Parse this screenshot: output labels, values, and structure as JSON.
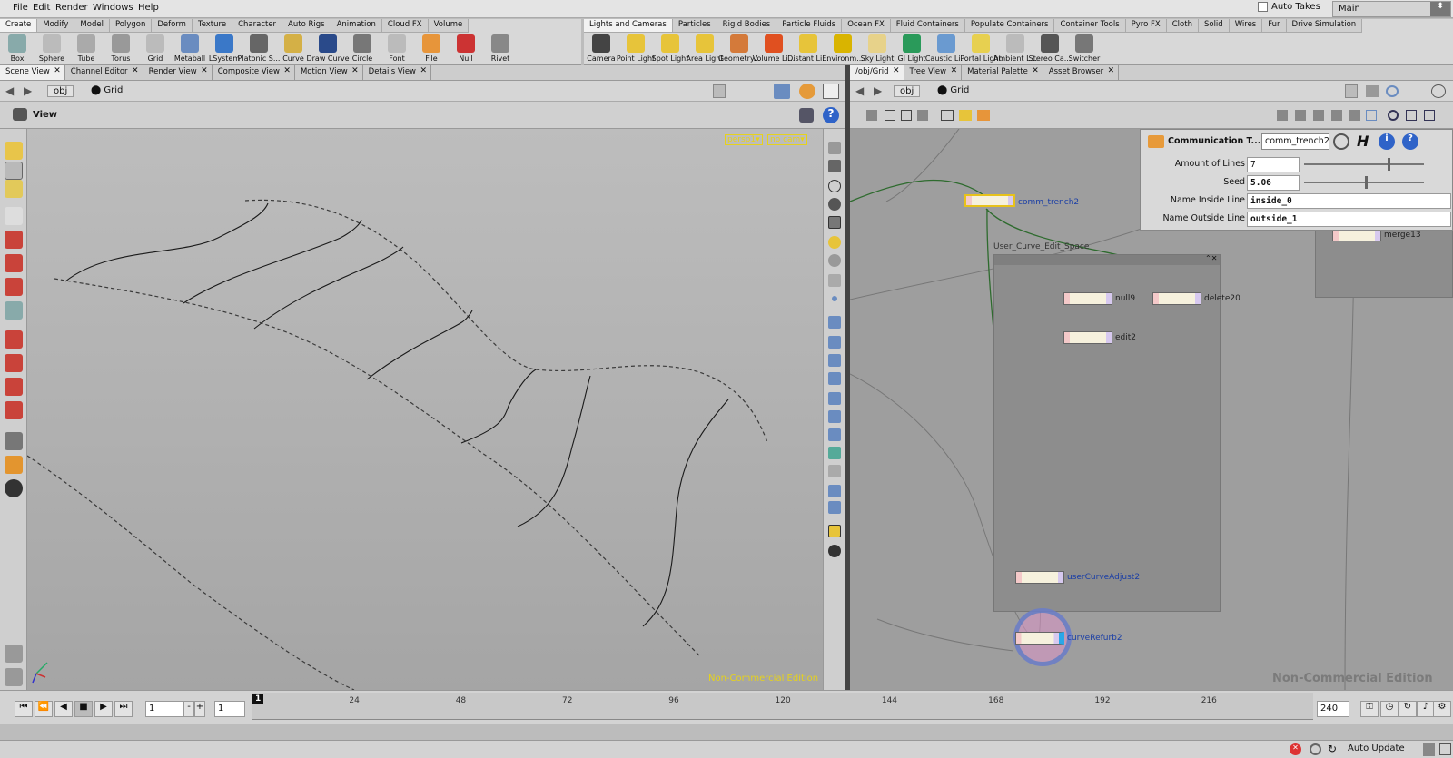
{
  "menubar": {
    "items": [
      "File",
      "Edit",
      "Render",
      "Windows",
      "Help"
    ],
    "auto_takes": "Auto Takes",
    "desktop": "Main"
  },
  "shelf_left": {
    "tabs": [
      "Create",
      "Modify",
      "Model",
      "Polygon",
      "Deform",
      "Texture",
      "Character",
      "Auto Rigs",
      "Animation",
      "Cloud FX",
      "Volume"
    ],
    "tools": [
      {
        "label": "Box",
        "icon": "box-icon"
      },
      {
        "label": "Sphere",
        "icon": "sphere-icon"
      },
      {
        "label": "Tube",
        "icon": "tube-icon"
      },
      {
        "label": "Torus",
        "icon": "torus-icon"
      },
      {
        "label": "Grid",
        "icon": "grid-icon"
      },
      {
        "label": "Metaball",
        "icon": "metaball-icon"
      },
      {
        "label": "LSystem",
        "icon": "lsystem-icon"
      },
      {
        "label": "Platonic S...",
        "icon": "platonic-icon"
      },
      {
        "label": "Curve",
        "icon": "curve-icon"
      },
      {
        "label": "Draw Curve",
        "icon": "draw-curve-icon"
      },
      {
        "label": "Circle",
        "icon": "circle-icon"
      },
      {
        "label": "Font",
        "icon": "font-icon"
      },
      {
        "label": "File",
        "icon": "file-icon"
      },
      {
        "label": "Null",
        "icon": "null-icon"
      },
      {
        "label": "Rivet",
        "icon": "rivet-icon"
      }
    ]
  },
  "shelf_right": {
    "tabs": [
      "Lights and Cameras",
      "Particles",
      "Rigid Bodies",
      "Particle Fluids",
      "Ocean FX",
      "Fluid Containers",
      "Populate Containers",
      "Container Tools",
      "Pyro FX",
      "Cloth",
      "Solid",
      "Wires",
      "Fur",
      "Drive Simulation"
    ],
    "tools": [
      {
        "label": "Camera",
        "icon": "camera-icon"
      },
      {
        "label": "Point Light",
        "icon": "point-light-icon"
      },
      {
        "label": "Spot Light",
        "icon": "spot-light-icon"
      },
      {
        "label": "Area Light",
        "icon": "area-light-icon"
      },
      {
        "label": "Geometry...",
        "icon": "geometry-light-icon"
      },
      {
        "label": "Volume Li...",
        "icon": "volume-light-icon"
      },
      {
        "label": "Distant Li...",
        "icon": "distant-light-icon"
      },
      {
        "label": "Environm...",
        "icon": "environment-light-icon"
      },
      {
        "label": "Sky Light",
        "icon": "sky-light-icon"
      },
      {
        "label": "GI Light",
        "icon": "gi-light-icon"
      },
      {
        "label": "Caustic Li...",
        "icon": "caustic-light-icon"
      },
      {
        "label": "Portal Light",
        "icon": "portal-light-icon"
      },
      {
        "label": "Ambient L...",
        "icon": "ambient-light-icon"
      },
      {
        "label": "Stereo Ca...",
        "icon": "stereo-camera-icon"
      },
      {
        "label": "Switcher",
        "icon": "switcher-icon"
      }
    ]
  },
  "left_pane": {
    "tabs": [
      "Scene View",
      "Channel Editor",
      "Render View",
      "Composite View",
      "Motion View",
      "Details View"
    ],
    "path": [
      "obj",
      "Grid"
    ],
    "view_label": "View",
    "camera_menu": "persp1▾",
    "cam_menu": "no cam▾",
    "watermark": "Non-Commercial Edition"
  },
  "right_pane": {
    "tabs": [
      "/obj/Grid",
      "Tree View",
      "Material Palette",
      "Asset Browser"
    ],
    "path": [
      "obj",
      "Grid"
    ],
    "watermark": "Non-Commercial Edition"
  },
  "parm": {
    "title": "Communication T...",
    "name": "comm_trench2",
    "rows": [
      {
        "label": "Amount of Lines",
        "value": "7"
      },
      {
        "label": "Seed",
        "value": "5.06"
      },
      {
        "label": "Name Inside Line",
        "value": "inside_0"
      },
      {
        "label": "Name Outside Line",
        "value": "outside_1"
      }
    ],
    "amount_fraction": 0.7,
    "seed_fraction": 0.51
  },
  "network": {
    "netbox_title": "User_Curve_Edit_Space",
    "nodes": [
      {
        "name": "comm_trench2"
      },
      {
        "name": "null9"
      },
      {
        "name": "delete20"
      },
      {
        "name": "edit2"
      },
      {
        "name": "userCurveAdjust2"
      },
      {
        "name": "curveRefurb2"
      },
      {
        "name": "merge13"
      }
    ]
  },
  "timeline": {
    "frame": "1",
    "start": "1",
    "end": "240",
    "current": "1",
    "ticks": [
      "24",
      "48",
      "72",
      "96",
      "120",
      "144",
      "168",
      "192",
      "216"
    ],
    "tick_frames": [
      24,
      48,
      72,
      96,
      120,
      144,
      168,
      192,
      216
    ],
    "auto_update": "Auto Update"
  }
}
